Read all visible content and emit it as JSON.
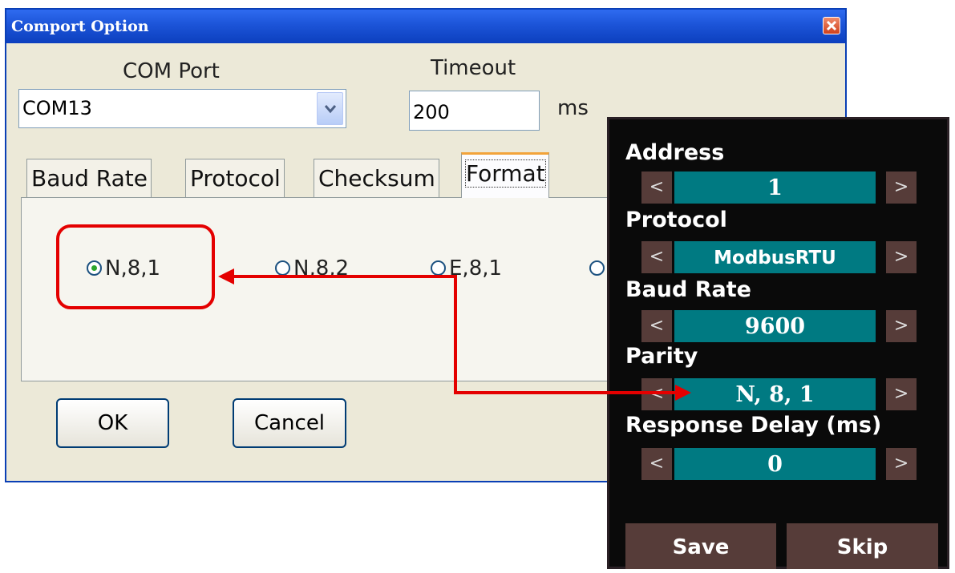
{
  "window": {
    "title": "Comport Option"
  },
  "com_port": {
    "label": "COM Port",
    "value": "COM13"
  },
  "timeout": {
    "label": "Timeout",
    "value": "200",
    "unit": "ms"
  },
  "tabs": [
    {
      "label": "Baud Rate",
      "active": false
    },
    {
      "label": "Protocol",
      "active": false
    },
    {
      "label": "Checksum",
      "active": false
    },
    {
      "label": "Format",
      "active": true
    }
  ],
  "format_options": [
    {
      "label": "N,8,1",
      "selected": true
    },
    {
      "label": "N,8,2",
      "selected": false
    },
    {
      "label": "E,8,1",
      "selected": false
    }
  ],
  "buttons": {
    "ok": "OK",
    "cancel": "Cancel"
  },
  "device": {
    "fields": [
      {
        "label": "Address",
        "value": "1"
      },
      {
        "label": "Protocol",
        "value": "ModbusRTU"
      },
      {
        "label": "Baud Rate",
        "value": "9600"
      },
      {
        "label": "Parity",
        "value": "N, 8, 1"
      },
      {
        "label": "Response Delay (ms)",
        "value": "0"
      }
    ],
    "prev_glyph": "<",
    "next_glyph": ">",
    "save": "Save",
    "skip": "Skip"
  },
  "colors": {
    "highlight": "#e40000",
    "titlebar": "#1c54d8",
    "field_bg": "#007a82"
  }
}
